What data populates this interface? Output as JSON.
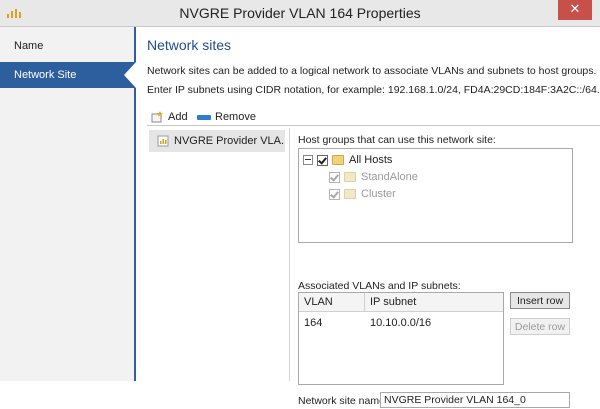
{
  "window": {
    "title": "NVGRE Provider VLAN 164 Properties",
    "close_glyph": "✕"
  },
  "sidebar": {
    "items": [
      {
        "label": "Name",
        "active": false
      },
      {
        "label": "Network Site",
        "active": true
      }
    ]
  },
  "main": {
    "heading": "Network sites",
    "description": "Network sites can be added to a logical network to associate VLANs and subnets to host groups.",
    "cidr_hint": "Enter IP subnets using CIDR notation, for example: 192.168.1.0/24, FD4A:29CD:184F:3A2C::/64.",
    "toolbar": {
      "add_label": "Add",
      "remove_label": "Remove"
    },
    "sites": [
      {
        "label": "NVGRE Provider VLA..."
      }
    ],
    "host_groups_label": "Host groups that can use this network site:",
    "host_groups": [
      {
        "label": "All Hosts",
        "checked": true,
        "enabled": true
      },
      {
        "label": "StandAlone",
        "checked": true,
        "enabled": false
      },
      {
        "label": "Cluster",
        "checked": true,
        "enabled": false
      }
    ],
    "vlans_label": "Associated VLANs and IP subnets:",
    "vlan_table": {
      "columns": [
        "VLAN",
        "IP subnet"
      ],
      "rows": [
        {
          "vlan": "164",
          "subnet": "10.10.0.0/16"
        }
      ]
    },
    "insert_row_label": "Insert row",
    "delete_row_label": "Delete row",
    "site_name_label": "Network site name:",
    "site_name_value": "NVGRE Provider VLAN 164_0"
  },
  "colors": {
    "accent": "#2d5e9e",
    "heading": "#1f4e8c",
    "close": "#c7504b"
  },
  "icons": [
    "app-icon",
    "close-icon",
    "add-icon",
    "remove-icon",
    "network-site-icon",
    "expander-icon",
    "checkbox-icon",
    "host-group-icon"
  ]
}
